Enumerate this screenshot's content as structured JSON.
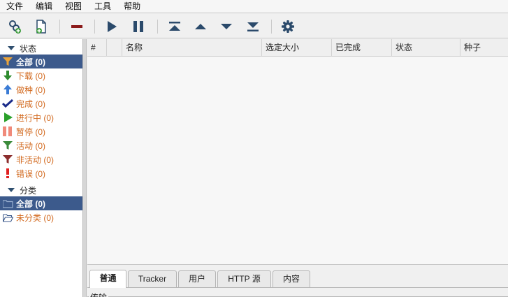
{
  "menu": [
    "文件",
    "编辑",
    "视图",
    "工具",
    "帮助"
  ],
  "sidebar": {
    "status_header": "状态",
    "status_items": [
      {
        "label": "全部 (0)",
        "icon": "filter-icon",
        "color": "#e8a33c"
      },
      {
        "label": "下载 (0)",
        "icon": "arrow-down-icon",
        "color": "#2e8b2e"
      },
      {
        "label": "做种 (0)",
        "icon": "arrow-up-icon",
        "color": "#3a7bd5"
      },
      {
        "label": "完成 (0)",
        "icon": "checkmark-icon",
        "color": "#1a2b8a"
      },
      {
        "label": "进行中 (0)",
        "icon": "play-icon",
        "color": "#2aa02a"
      },
      {
        "label": "暂停 (0)",
        "icon": "pause-icon",
        "color": "#f08a7a"
      },
      {
        "label": "活动 (0)",
        "icon": "filter-icon",
        "color": "#3a8a3a"
      },
      {
        "label": "非活动 (0)",
        "icon": "filter-icon",
        "color": "#8b2e2e"
      },
      {
        "label": "错误 (0)",
        "icon": "exclamation-icon",
        "color": "#e02020"
      }
    ],
    "category_header": "分类",
    "category_items": [
      {
        "label": "全部 (0)",
        "icon": "folder-icon"
      },
      {
        "label": "未分类 (0)",
        "icon": "folder-open-icon"
      }
    ]
  },
  "table": {
    "columns": [
      "#",
      "",
      "名称",
      "选定大小",
      "已完成",
      "状态",
      "种子"
    ]
  },
  "tabs": [
    "普通",
    "Tracker",
    "用户",
    "HTTP 源",
    "内容"
  ],
  "details": {
    "legend": "传输"
  }
}
